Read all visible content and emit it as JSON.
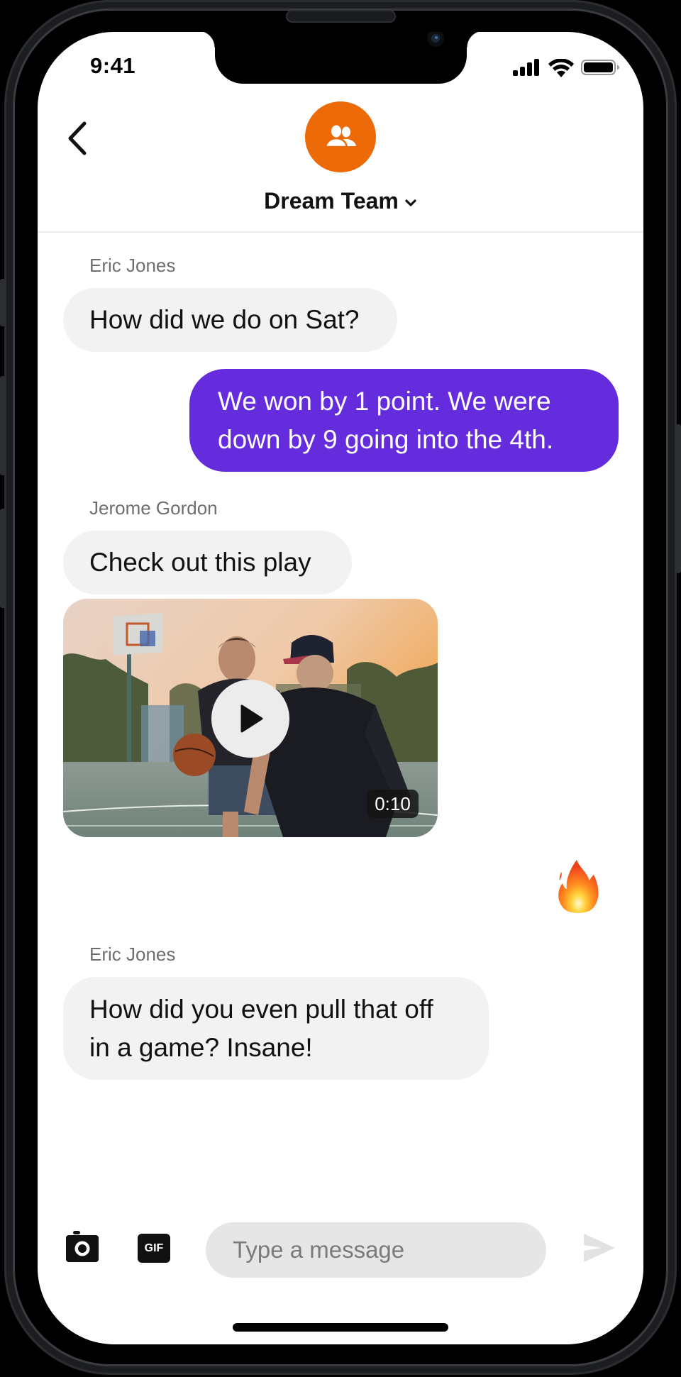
{
  "status_bar": {
    "time": "9:41"
  },
  "header": {
    "group_name": "Dream Team",
    "avatar_icon": "group-people-icon",
    "avatar_color": "#EC6A08",
    "back_icon": "chevron-left-icon",
    "dropdown_icon": "chevron-down-icon"
  },
  "messages": [
    {
      "sender": "Eric Jones",
      "text": "How did we do on Sat?",
      "outgoing": false
    },
    {
      "sender": "",
      "text_lines": [
        "We won by 1 point. We were",
        "down by 9 going into the 4th."
      ],
      "outgoing": true,
      "color": "#652CDE"
    },
    {
      "sender": "Jerome Gordon",
      "text": "Check out this play",
      "outgoing": false
    },
    {
      "type": "video",
      "duration": "0:10",
      "play_icon": "play-icon"
    },
    {
      "type": "reaction",
      "emoji": "🔥",
      "icon": "fire-icon",
      "outgoing": true
    },
    {
      "sender": "Eric Jones",
      "text_lines": [
        "How did you even pull that off",
        "in a game? Insane!"
      ],
      "outgoing": false
    }
  ],
  "composer": {
    "placeholder": "Type a message",
    "value": "",
    "camera_icon": "camera-icon",
    "gif_label": "GIF",
    "send_icon": "send-icon"
  }
}
